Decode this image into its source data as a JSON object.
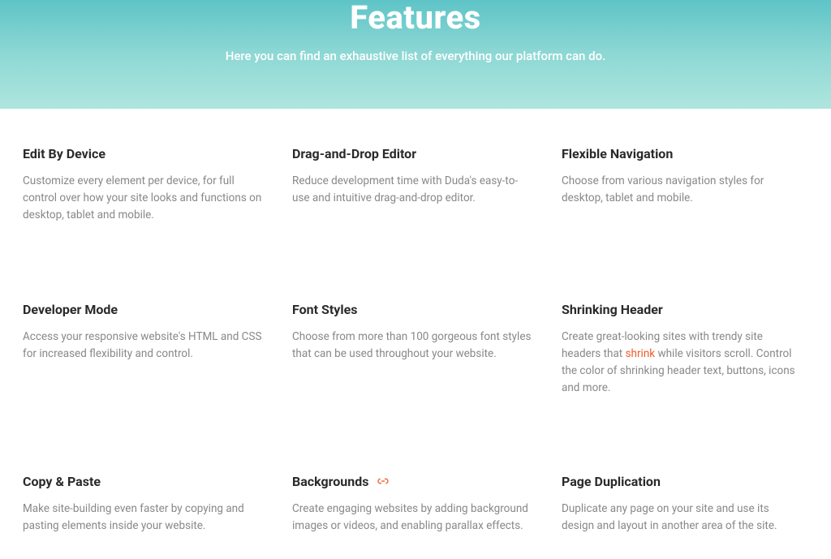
{
  "hero": {
    "title": "Features",
    "subtitle": "Here you can find an exhaustive list of everything our platform can do."
  },
  "features": [
    {
      "title": "Edit By Device",
      "desc": "Customize every element per device, for full control over how your site looks and functions on desktop, tablet and mobile."
    },
    {
      "title": "Drag-and-Drop Editor",
      "desc": "Reduce development time with Duda's easy-to-use and intuitive drag-and-drop editor."
    },
    {
      "title": "Flexible Navigation",
      "desc": "Choose from various navigation styles for desktop, tablet and mobile."
    },
    {
      "title": "Developer Mode",
      "desc": "Access your responsive website's HTML and CSS for increased flexibility and control."
    },
    {
      "title": "Font Styles",
      "desc": "Choose from more than 100 gorgeous font styles that can be used throughout your website."
    },
    {
      "title": "Shrinking Header",
      "desc_before": "Create great-looking sites with trendy site headers that ",
      "desc_link": "shrink",
      "desc_after": " while visitors scroll. Control the color of shrinking header text, buttons, icons and more."
    },
    {
      "title": "Copy & Paste",
      "desc": "Make site-building even faster by copying and pasting elements inside your website."
    },
    {
      "title": "Backgrounds",
      "icon": "link",
      "desc": "Create engaging websites by adding background images or videos, and enabling parallax effects."
    },
    {
      "title": "Page Duplication",
      "desc": "Duplicate any page on your site and use its design and layout in another area of the site."
    }
  ]
}
